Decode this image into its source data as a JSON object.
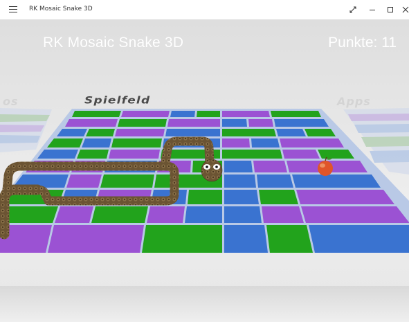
{
  "window": {
    "title": "RK Mosaic Snake 3D",
    "controls": [
      "maximize-icon",
      "minimize-icon",
      "restore-icon",
      "close-icon"
    ]
  },
  "game": {
    "title": "RK Mosaic Snake 3D",
    "score_text": "Punkte: 11",
    "field_label": "Spielfeld",
    "left_panel_label": "os",
    "right_panel_label": "Apps"
  },
  "colors": {
    "green": "#22a31c",
    "purple": "#9b52d3",
    "blue": "#3a73d0",
    "grid_line": "#b8c8e8",
    "snake": "#6a5232",
    "apple": "#e0552a"
  }
}
